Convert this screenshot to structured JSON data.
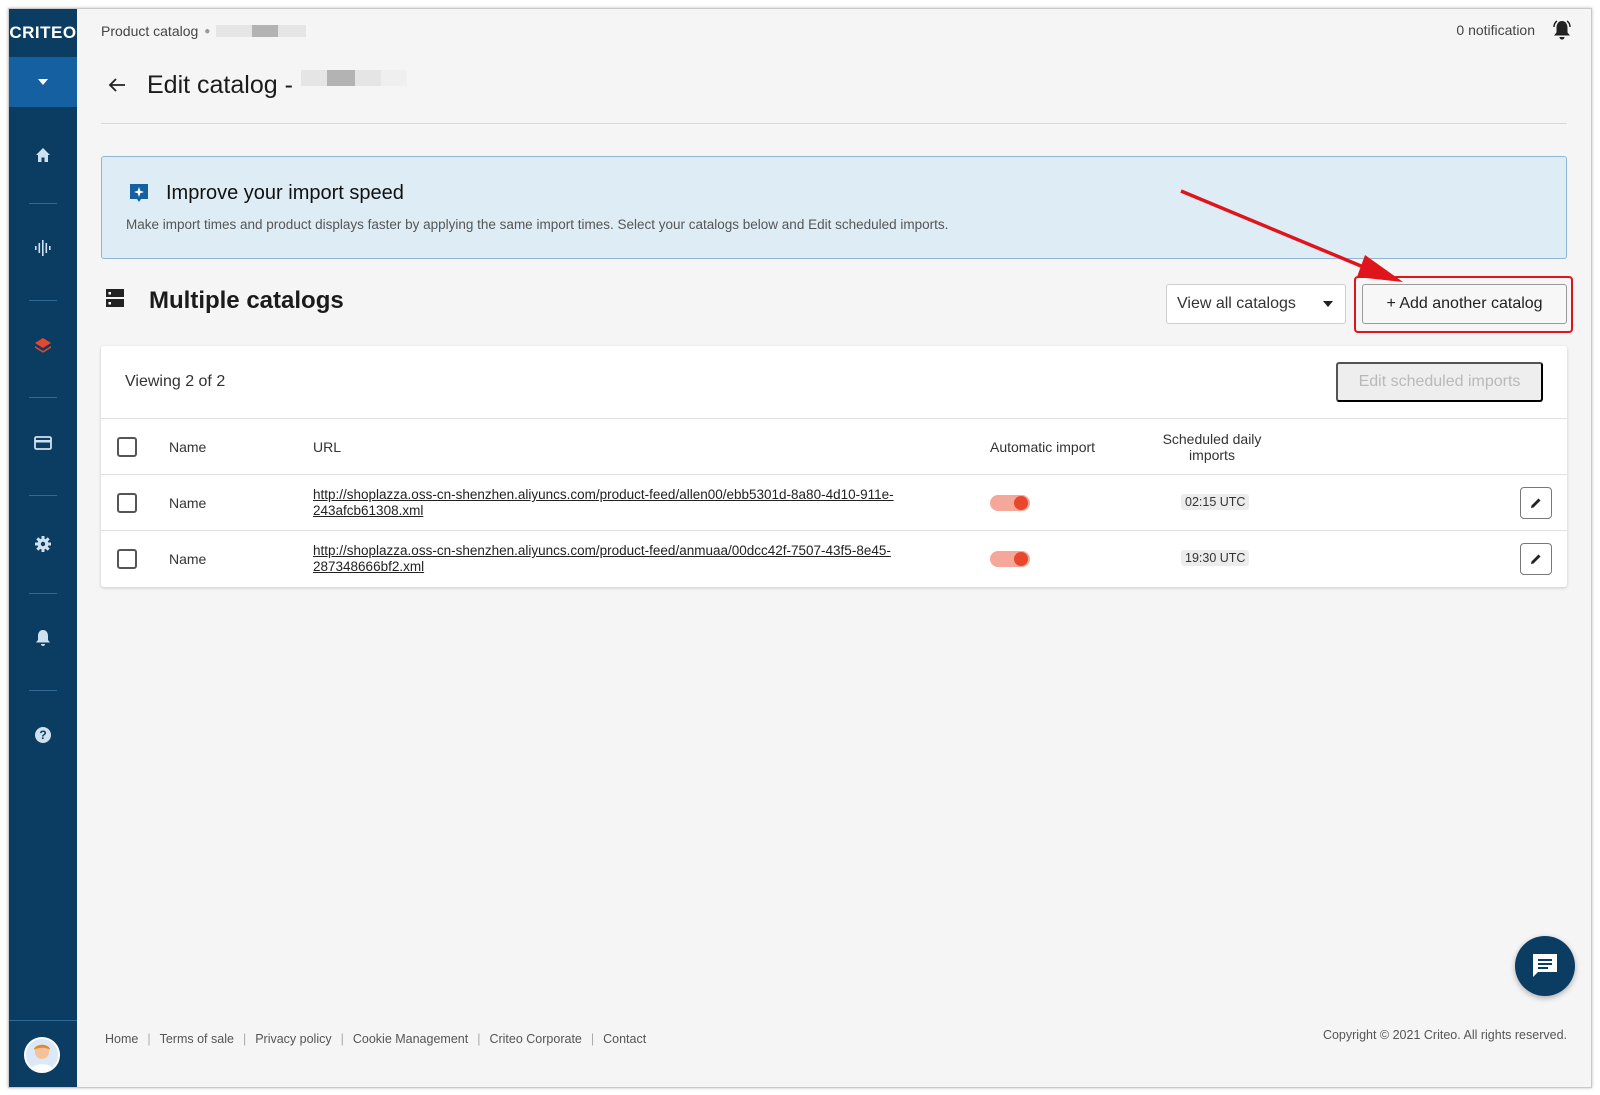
{
  "sidebar": {
    "logo": "CRITEO",
    "items": [
      {
        "icon": "home-icon"
      },
      {
        "icon": "audio-wave-icon"
      },
      {
        "icon": "layers-icon"
      },
      {
        "icon": "credit-card-icon"
      },
      {
        "icon": "gear-icon"
      },
      {
        "icon": "bell-icon"
      },
      {
        "icon": "help-icon"
      }
    ],
    "active_color": "#e8472b"
  },
  "breadcrumb": {
    "first": "Product catalog"
  },
  "header": {
    "notification_text": "0 notification"
  },
  "page": {
    "title": "Edit catalog -"
  },
  "banner": {
    "title": "Improve your import speed",
    "text": "Make import times and product displays faster by applying the same import times. Select your catalogs below and Edit scheduled imports."
  },
  "section": {
    "title": "Multiple catalogs",
    "view_select": "View all catalogs",
    "add_button": "+ Add another catalog"
  },
  "table": {
    "viewing": "Viewing 2 of 2",
    "edit_scheduled": "Edit scheduled imports",
    "columns": {
      "name": "Name",
      "url": "URL",
      "auto": "Automatic import",
      "sched": "Scheduled daily imports"
    },
    "rows": [
      {
        "name": "Name",
        "url": "http://shoplazza.oss-cn-shenzhen.aliyuncs.com/product-feed/allen00/ebb5301d-8a80-4d10-911e-243afcb61308.xml",
        "automatic": true,
        "time": "02:15 UTC"
      },
      {
        "name": "Name",
        "url": "http://shoplazza.oss-cn-shenzhen.aliyuncs.com/product-feed/anmuaa/00dcc42f-7507-43f5-8e45-287348666bf2.xml",
        "automatic": true,
        "time": "19:30 UTC"
      }
    ]
  },
  "footer": {
    "links": [
      "Home",
      "Terms of sale",
      "Privacy policy",
      "Cookie Management",
      "Criteo Corporate",
      "Contact"
    ],
    "copyright": "Copyright © 2021 Criteo. All rights reserved."
  },
  "colors": {
    "sidebar": "#0b3d63",
    "accent_red": "#e0141b",
    "toggle_on": "#e8472b",
    "banner_bg": "#deedf5"
  }
}
